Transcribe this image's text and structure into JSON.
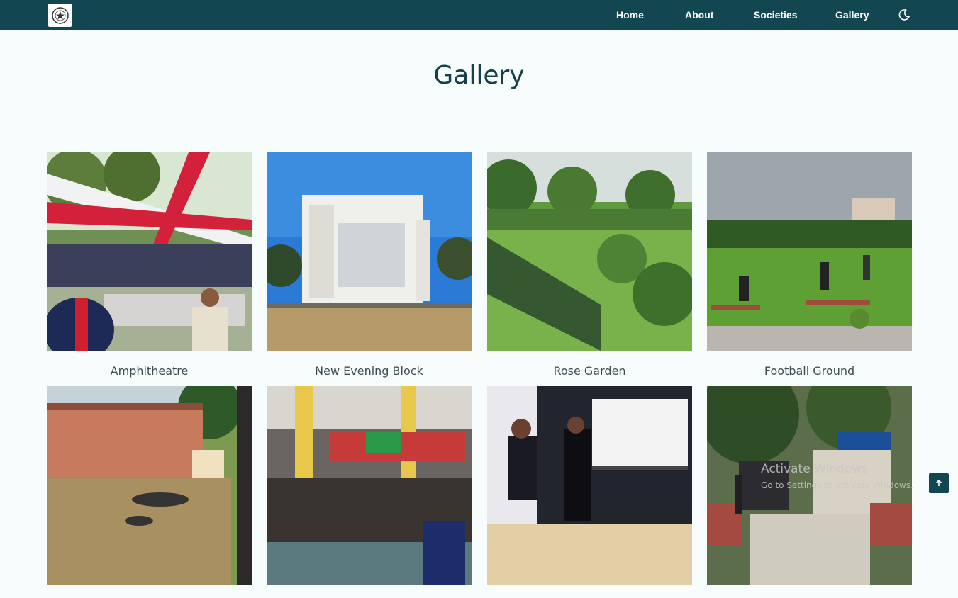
{
  "nav": {
    "logo_icon": "college-crest-logo-icon",
    "links": [
      {
        "label": "Home"
      },
      {
        "label": "About"
      },
      {
        "label": "Societies"
      },
      {
        "label": "Gallery"
      }
    ],
    "theme_toggle_icon": "moon-icon"
  },
  "page": {
    "title": "Gallery"
  },
  "gallery": {
    "items": [
      {
        "caption": "Amphitheatre",
        "photo": "amphitheatre-photo"
      },
      {
        "caption": "New Evening Block",
        "photo": "new-evening-block-photo"
      },
      {
        "caption": "Rose Garden",
        "photo": "rose-garden-photo"
      },
      {
        "caption": "Football Ground",
        "photo": "football-ground-photo"
      },
      {
        "caption": "",
        "photo": "college-building-lawn-photo"
      },
      {
        "caption": "",
        "photo": "canteen-photo"
      },
      {
        "caption": "",
        "photo": "stage-presentation-photo"
      },
      {
        "caption": "",
        "photo": "college-gate-photo"
      }
    ]
  },
  "scroll_top_icon": "arrow-up-icon",
  "os_watermark": {
    "line1": "Activate Windows",
    "line2": "Go to Settings to activate Windows."
  },
  "colors": {
    "navbar": "#124650",
    "background": "#f7fcfc",
    "title": "#15404a"
  }
}
